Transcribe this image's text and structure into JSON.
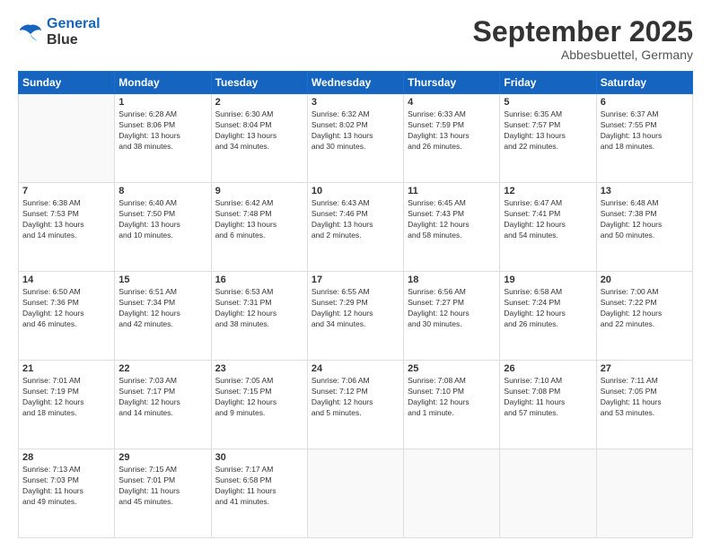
{
  "header": {
    "logo_line1": "General",
    "logo_line2": "Blue",
    "month": "September 2025",
    "location": "Abbesbuettel, Germany"
  },
  "weekdays": [
    "Sunday",
    "Monday",
    "Tuesday",
    "Wednesday",
    "Thursday",
    "Friday",
    "Saturday"
  ],
  "weeks": [
    [
      {
        "num": "",
        "info": ""
      },
      {
        "num": "1",
        "info": "Sunrise: 6:28 AM\nSunset: 8:06 PM\nDaylight: 13 hours\nand 38 minutes."
      },
      {
        "num": "2",
        "info": "Sunrise: 6:30 AM\nSunset: 8:04 PM\nDaylight: 13 hours\nand 34 minutes."
      },
      {
        "num": "3",
        "info": "Sunrise: 6:32 AM\nSunset: 8:02 PM\nDaylight: 13 hours\nand 30 minutes."
      },
      {
        "num": "4",
        "info": "Sunrise: 6:33 AM\nSunset: 7:59 PM\nDaylight: 13 hours\nand 26 minutes."
      },
      {
        "num": "5",
        "info": "Sunrise: 6:35 AM\nSunset: 7:57 PM\nDaylight: 13 hours\nand 22 minutes."
      },
      {
        "num": "6",
        "info": "Sunrise: 6:37 AM\nSunset: 7:55 PM\nDaylight: 13 hours\nand 18 minutes."
      }
    ],
    [
      {
        "num": "7",
        "info": "Sunrise: 6:38 AM\nSunset: 7:53 PM\nDaylight: 13 hours\nand 14 minutes."
      },
      {
        "num": "8",
        "info": "Sunrise: 6:40 AM\nSunset: 7:50 PM\nDaylight: 13 hours\nand 10 minutes."
      },
      {
        "num": "9",
        "info": "Sunrise: 6:42 AM\nSunset: 7:48 PM\nDaylight: 13 hours\nand 6 minutes."
      },
      {
        "num": "10",
        "info": "Sunrise: 6:43 AM\nSunset: 7:46 PM\nDaylight: 13 hours\nand 2 minutes."
      },
      {
        "num": "11",
        "info": "Sunrise: 6:45 AM\nSunset: 7:43 PM\nDaylight: 12 hours\nand 58 minutes."
      },
      {
        "num": "12",
        "info": "Sunrise: 6:47 AM\nSunset: 7:41 PM\nDaylight: 12 hours\nand 54 minutes."
      },
      {
        "num": "13",
        "info": "Sunrise: 6:48 AM\nSunset: 7:38 PM\nDaylight: 12 hours\nand 50 minutes."
      }
    ],
    [
      {
        "num": "14",
        "info": "Sunrise: 6:50 AM\nSunset: 7:36 PM\nDaylight: 12 hours\nand 46 minutes."
      },
      {
        "num": "15",
        "info": "Sunrise: 6:51 AM\nSunset: 7:34 PM\nDaylight: 12 hours\nand 42 minutes."
      },
      {
        "num": "16",
        "info": "Sunrise: 6:53 AM\nSunset: 7:31 PM\nDaylight: 12 hours\nand 38 minutes."
      },
      {
        "num": "17",
        "info": "Sunrise: 6:55 AM\nSunset: 7:29 PM\nDaylight: 12 hours\nand 34 minutes."
      },
      {
        "num": "18",
        "info": "Sunrise: 6:56 AM\nSunset: 7:27 PM\nDaylight: 12 hours\nand 30 minutes."
      },
      {
        "num": "19",
        "info": "Sunrise: 6:58 AM\nSunset: 7:24 PM\nDaylight: 12 hours\nand 26 minutes."
      },
      {
        "num": "20",
        "info": "Sunrise: 7:00 AM\nSunset: 7:22 PM\nDaylight: 12 hours\nand 22 minutes."
      }
    ],
    [
      {
        "num": "21",
        "info": "Sunrise: 7:01 AM\nSunset: 7:19 PM\nDaylight: 12 hours\nand 18 minutes."
      },
      {
        "num": "22",
        "info": "Sunrise: 7:03 AM\nSunset: 7:17 PM\nDaylight: 12 hours\nand 14 minutes."
      },
      {
        "num": "23",
        "info": "Sunrise: 7:05 AM\nSunset: 7:15 PM\nDaylight: 12 hours\nand 9 minutes."
      },
      {
        "num": "24",
        "info": "Sunrise: 7:06 AM\nSunset: 7:12 PM\nDaylight: 12 hours\nand 5 minutes."
      },
      {
        "num": "25",
        "info": "Sunrise: 7:08 AM\nSunset: 7:10 PM\nDaylight: 12 hours\nand 1 minute."
      },
      {
        "num": "26",
        "info": "Sunrise: 7:10 AM\nSunset: 7:08 PM\nDaylight: 11 hours\nand 57 minutes."
      },
      {
        "num": "27",
        "info": "Sunrise: 7:11 AM\nSunset: 7:05 PM\nDaylight: 11 hours\nand 53 minutes."
      }
    ],
    [
      {
        "num": "28",
        "info": "Sunrise: 7:13 AM\nSunset: 7:03 PM\nDaylight: 11 hours\nand 49 minutes."
      },
      {
        "num": "29",
        "info": "Sunrise: 7:15 AM\nSunset: 7:01 PM\nDaylight: 11 hours\nand 45 minutes."
      },
      {
        "num": "30",
        "info": "Sunrise: 7:17 AM\nSunset: 6:58 PM\nDaylight: 11 hours\nand 41 minutes."
      },
      {
        "num": "",
        "info": ""
      },
      {
        "num": "",
        "info": ""
      },
      {
        "num": "",
        "info": ""
      },
      {
        "num": "",
        "info": ""
      }
    ]
  ]
}
